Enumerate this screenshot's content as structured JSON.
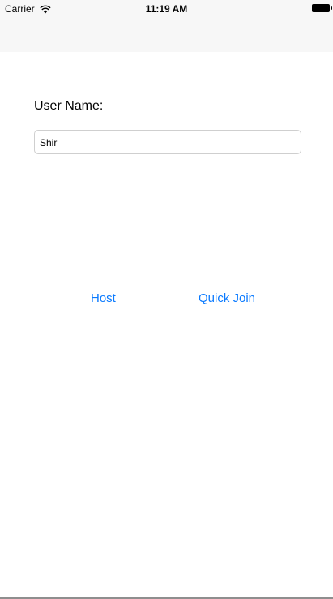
{
  "status_bar": {
    "carrier": "Carrier",
    "time": "11:19 AM",
    "wifi_icon": "wifi-icon",
    "battery_icon": "battery-icon"
  },
  "form": {
    "label": "User Name:",
    "username_value": "Shir"
  },
  "actions": {
    "host_label": "Host",
    "quick_join_label": "Quick Join"
  },
  "colors": {
    "accent": "#0a7aff",
    "bar_background": "#f7f7f7"
  }
}
